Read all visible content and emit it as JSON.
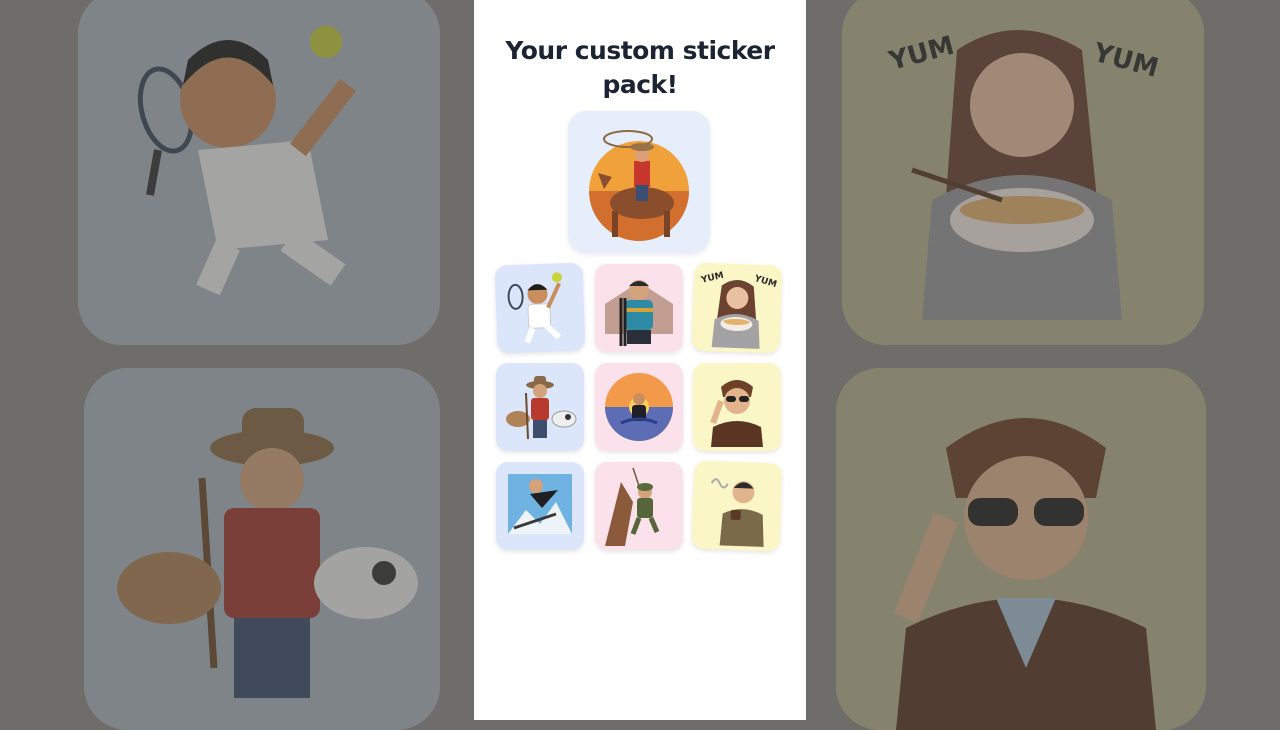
{
  "title": "Your custom sticker pack!",
  "colors": {
    "tile_blue": "#dbe6fb",
    "tile_pink": "#fbe1ea",
    "tile_yellow": "#fbf6c6",
    "title_text": "#1c2433"
  },
  "background_texts": {
    "yum_left": "YUM",
    "yum_right": "YUM"
  },
  "hero_sticker": {
    "subject": "cowboy-on-horse-sticker"
  },
  "stickers": [
    {
      "subject": "tennis-player-sticker",
      "tint": "blue"
    },
    {
      "subject": "skier-with-skis-sticker",
      "tint": "pink"
    },
    {
      "subject": "girl-eating-ramen-sticker",
      "tint": "yellow",
      "texts": [
        "YUM",
        "YUM"
      ]
    },
    {
      "subject": "farmer-with-cows-sticker",
      "tint": "blue"
    },
    {
      "subject": "surfer-at-sunset-sticker",
      "tint": "pink"
    },
    {
      "subject": "aviator-saluting-sticker",
      "tint": "yellow"
    },
    {
      "subject": "ski-jumper-sticker",
      "tint": "blue"
    },
    {
      "subject": "soldier-climbing-sticker",
      "tint": "pink"
    },
    {
      "subject": "man-with-coffee-sticker",
      "tint": "yellow"
    }
  ]
}
